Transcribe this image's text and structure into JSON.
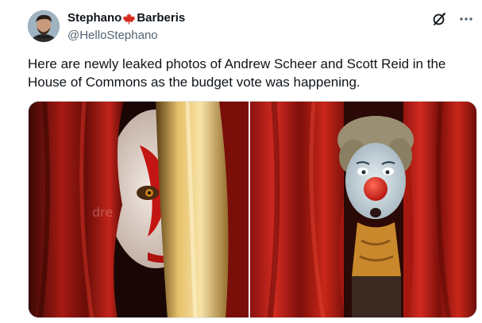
{
  "author": {
    "name_first": "Stephano",
    "name_last": "Barberis",
    "flag_icon": "maple-leaf-icon",
    "handle": "@HelloStephano"
  },
  "header_icons": [
    "grok-icon",
    "more-icon"
  ],
  "tweet": {
    "text": "Here are newly leaked photos of Andrew Scheer and Scott Reid in the House of Commons as the budget vote was happening."
  },
  "media": {
    "count": 2,
    "watermark": "dre"
  },
  "colors": {
    "text": "#0f1419",
    "secondary": "#536471",
    "flag_red": "#d52b1e",
    "curtain_red": "#b01818"
  }
}
